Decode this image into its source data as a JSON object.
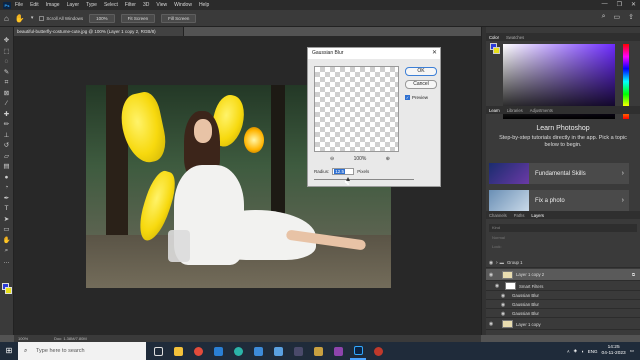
{
  "menubar": {
    "items": [
      "File",
      "Edit",
      "Image",
      "Layer",
      "Type",
      "Select",
      "Filter",
      "3D",
      "View",
      "Window",
      "Help"
    ]
  },
  "options": {
    "scroll_all_label": "Scroll All Windows",
    "zoom_100": "100%",
    "fit_screen": "Fit Screen",
    "fill_screen": "Fill Screen"
  },
  "document": {
    "tab_title": "beautiful-butterfly-costume-cute.jpg @ 100% (Layer 1 copy 2, RGB/8)"
  },
  "dialog": {
    "title": "Gaussian Blur",
    "ok": "OK",
    "cancel": "Cancel",
    "preview": "Preview",
    "zoom": "100%",
    "radius_label": "Radius:",
    "radius_value": "12.5",
    "units": "Pixels"
  },
  "color_panel": {
    "tabs": [
      "Color",
      "Swatches"
    ]
  },
  "learn_panel": {
    "tabs": [
      "Learn",
      "Libraries",
      "Adjustments"
    ],
    "title": "Learn Photoshop",
    "subtitle": "Step-by-step tutorials directly in the app. Pick a topic below to begin.",
    "cards": [
      "Fundamental Skills",
      "Fix a photo"
    ]
  },
  "layers_panel": {
    "tabs": [
      "Channels",
      "Paths",
      "Layers"
    ],
    "filter": "Kind",
    "mode": "Normal",
    "lock": "Lock:",
    "rows": [
      {
        "name": "Group 1"
      },
      {
        "name": "Layer 1 copy 2"
      },
      {
        "name": "Smart Filters"
      },
      {
        "name": "Gaussian Blur"
      },
      {
        "name": "Gaussian Blur"
      },
      {
        "name": "Gaussian Blur"
      },
      {
        "name": "Layer 1 copy"
      }
    ]
  },
  "status": {
    "zoom": "100%",
    "doc": "Doc: 1.38M/7.80M"
  },
  "taskbar": {
    "search_placeholder": "Type here to search",
    "lang": "ENG",
    "time": "14:25",
    "date": "04-11-2023"
  }
}
